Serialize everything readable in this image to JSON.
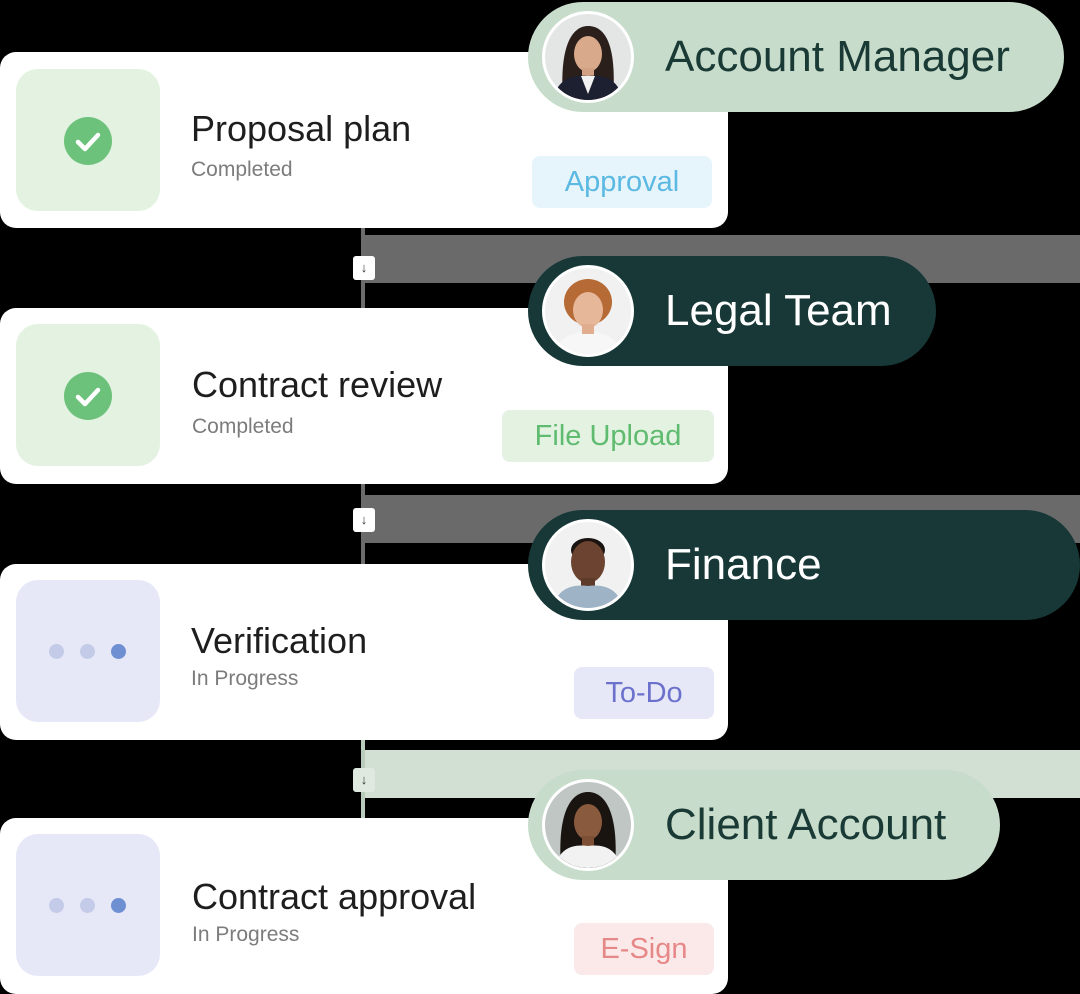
{
  "steps": [
    {
      "title": "Proposal plan",
      "status": "Completed",
      "tag": "Approval",
      "role": "Account Manager"
    },
    {
      "title": "Contract review",
      "status": "Completed",
      "tag": "File Upload",
      "role": "Legal Team"
    },
    {
      "title": "Verification",
      "status": "In Progress",
      "tag": "To-Do",
      "role": "Finance"
    },
    {
      "title": "Contract approval",
      "status": "In Progress",
      "tag": "E-Sign",
      "role": "Client Account"
    }
  ],
  "connector_arrow": "↓",
  "colors": {
    "completed": "#6cc27a",
    "in_progress": "#6e8fd1",
    "dark_pill": "#173837",
    "light_pill": "#c8dccb"
  }
}
